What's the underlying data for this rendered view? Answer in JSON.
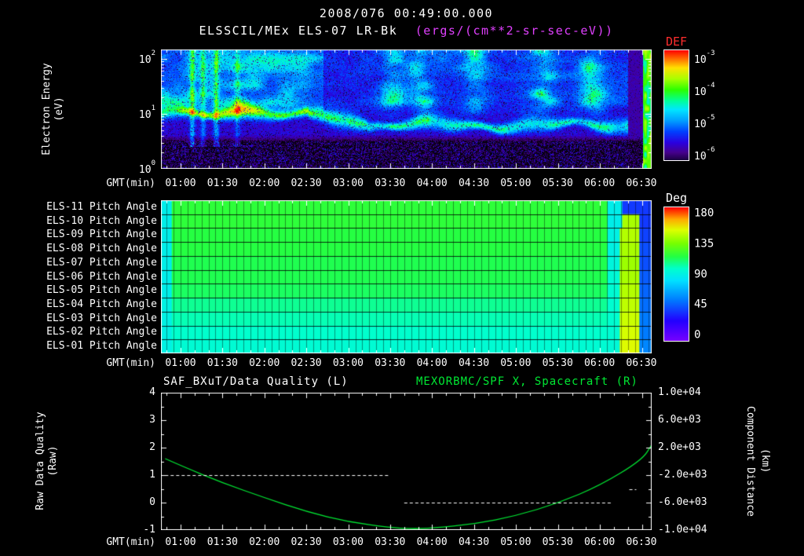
{
  "header": {
    "title": "2008/076 00:49:00.000"
  },
  "colors": {
    "background": "#000000",
    "foreground": "#ffffff",
    "panel1_units_magenta": "#e040ff",
    "def_label_red": "#ff2d2d",
    "right_title_green": "#00e833"
  },
  "time_axis": {
    "label": "GMT(min)",
    "ticks": [
      "01:00",
      "01:30",
      "02:00",
      "02:30",
      "03:00",
      "03:30",
      "04:00",
      "04:30",
      "05:00",
      "05:30",
      "06:00",
      "06:30"
    ],
    "start_min": 46,
    "end_min": 397
  },
  "panel1": {
    "title": "ELSSCIL/MEx ELS-07 LR-Bk",
    "units": "(ergs/(cm**2-sr-sec-eV))",
    "ylabel": "Electron Energy",
    "ylabel_units": "(eV)",
    "yticks": [
      {
        "base": "10",
        "exp": "2"
      },
      {
        "base": "10",
        "exp": "1"
      },
      {
        "base": "10",
        "exp": "0"
      }
    ],
    "colorbar": {
      "label": "DEF",
      "ticks": [
        {
          "base": "10",
          "exp": "-3"
        },
        {
          "base": "10",
          "exp": "-4"
        },
        {
          "base": "10",
          "exp": "-5"
        },
        {
          "base": "10",
          "exp": "-6"
        }
      ]
    }
  },
  "panel2": {
    "colorbar": {
      "label": "Deg",
      "ticks": [
        "180",
        "135",
        "90",
        "45",
        "0"
      ]
    }
  },
  "panel3": {
    "title_left": "SAF_BXuT/Data Quality (L)",
    "title_right": "MEXORBMC/SPF X, Spacecraft (R)",
    "ylabel_left": "Raw Data Quality",
    "ylabel_left_units": "(Raw)",
    "yticks_left": [
      "4",
      "3",
      "2",
      "1",
      "0",
      "-1"
    ],
    "ylabel_right": "Component Distance",
    "ylabel_right_units": "(km)",
    "yticks_right": [
      "1.0e+04",
      "6.0e+03",
      "2.0e+03",
      "-2.0e+03",
      "-6.0e+03",
      "-1.0e+04"
    ]
  },
  "chart_data": [
    {
      "type": "heatmap",
      "subtype": "energy-time-spectrogram",
      "title": "ELSSCIL/MEx ELS-07 LR-Bk",
      "zlabel": "DEF (ergs/(cm**2-sr-sec-eV))",
      "xlabel": "GMT(min)",
      "ylabel": "Electron Energy (eV)",
      "yscale": "log",
      "ylim_eV": [
        1,
        150
      ],
      "zlim": [
        1e-06,
        0.001
      ],
      "x_range": [
        "00:46",
        "06:37"
      ],
      "x_ticks": [
        "01:00",
        "01:30",
        "02:00",
        "02:30",
        "03:00",
        "03:30",
        "04:00",
        "04:30",
        "05:00",
        "05:30",
        "06:00",
        "06:30"
      ],
      "features": [
        "broad cyan-green electron flux 5-100 eV from 01:00 to 02:30",
        "narrow cyan band near 6-10 eV wavering across the full interval",
        "patchy cyan and green clouds 20-150 eV between 03:30 and 06:10",
        "dark speckled low-flux background below ~3 eV",
        "dark blue gap near 06:20 then bright green full-height column at ~06:33"
      ]
    },
    {
      "type": "heatmap",
      "subtype": "pitch-angle-rows",
      "zlabel": "Deg",
      "zlim": [
        0,
        180
      ],
      "rows": [
        {
          "label": "ELS-11 Pitch Angle",
          "segments": [
            [
              0,
              0.022,
              88
            ],
            [
              0.022,
              0.91,
              116
            ],
            [
              0.91,
              0.94,
              88
            ],
            [
              0.94,
              1,
              40
            ]
          ]
        },
        {
          "label": "ELS-10 Pitch Angle",
          "segments": [
            [
              0,
              0.022,
              88
            ],
            [
              0.022,
              0.91,
              116
            ],
            [
              0.91,
              0.94,
              88
            ],
            [
              0.94,
              0.975,
              140
            ],
            [
              0.975,
              1,
              40
            ]
          ]
        },
        {
          "label": "ELS-09 Pitch Angle",
          "segments": [
            [
              0,
              0.022,
              88
            ],
            [
              0.022,
              0.91,
              114
            ],
            [
              0.91,
              0.935,
              90
            ],
            [
              0.935,
              0.975,
              142
            ],
            [
              0.975,
              1,
              42
            ]
          ]
        },
        {
          "label": "ELS-08 Pitch Angle",
          "segments": [
            [
              0,
              0.022,
              88
            ],
            [
              0.022,
              0.91,
              114
            ],
            [
              0.91,
              0.935,
              90
            ],
            [
              0.935,
              0.975,
              140
            ],
            [
              0.975,
              1,
              45
            ]
          ]
        },
        {
          "label": "ELS-07 Pitch Angle",
          "segments": [
            [
              0,
              0.022,
              88
            ],
            [
              0.022,
              0.91,
              112
            ],
            [
              0.91,
              0.935,
              92
            ],
            [
              0.935,
              0.975,
              138
            ],
            [
              0.975,
              1,
              45
            ]
          ]
        },
        {
          "label": "ELS-06 Pitch Angle",
          "segments": [
            [
              0,
              0.022,
              88
            ],
            [
              0.022,
              0.91,
              112
            ],
            [
              0.91,
              0.935,
              94
            ],
            [
              0.935,
              0.975,
              140
            ],
            [
              0.975,
              1,
              48
            ]
          ]
        },
        {
          "label": "ELS-05 Pitch Angle",
          "segments": [
            [
              0,
              0.022,
              88
            ],
            [
              0.022,
              0.91,
              110
            ],
            [
              0.91,
              0.935,
              95
            ],
            [
              0.935,
              0.975,
              142
            ],
            [
              0.975,
              1,
              50
            ]
          ]
        },
        {
          "label": "ELS-04 Pitch Angle",
          "segments": [
            [
              0,
              0.022,
              90
            ],
            [
              0.022,
              0.91,
              104
            ],
            [
              0.91,
              0.935,
              96
            ],
            [
              0.935,
              0.975,
              144
            ],
            [
              0.975,
              1,
              52
            ]
          ]
        },
        {
          "label": "ELS-03 Pitch Angle",
          "segments": [
            [
              0,
              0.022,
              90
            ],
            [
              0.022,
              0.91,
              100
            ],
            [
              0.91,
              0.935,
              96
            ],
            [
              0.935,
              0.975,
              146
            ],
            [
              0.975,
              1,
              55
            ]
          ]
        },
        {
          "label": "ELS-02 Pitch Angle",
          "segments": [
            [
              0,
              0.022,
              90
            ],
            [
              0.022,
              0.91,
              97
            ],
            [
              0.91,
              0.935,
              95
            ],
            [
              0.935,
              0.975,
              148
            ],
            [
              0.975,
              1,
              55
            ]
          ]
        },
        {
          "label": "ELS-01 Pitch Angle",
          "segments": [
            [
              0,
              0.022,
              90
            ],
            [
              0.022,
              0.91,
              95
            ],
            [
              0.91,
              0.935,
              94
            ],
            [
              0.935,
              0.975,
              150
            ],
            [
              0.975,
              1,
              58
            ]
          ]
        }
      ]
    },
    {
      "type": "line",
      "xlabel": "GMT(min)",
      "left_axis": {
        "label": "Raw Data Quality (Raw)",
        "range": [
          -1,
          4
        ]
      },
      "right_axis": {
        "label": "Component Distance (km)",
        "range": [
          -10000,
          10000
        ]
      },
      "series": [
        {
          "name": "MEXORBMC/SPF X, Spacecraft (R)",
          "axis": "right",
          "color": "#00e833",
          "x_min": [
            49,
            60,
            90,
            120,
            150,
            180,
            210,
            225,
            240,
            270,
            300,
            330,
            360,
            390,
            397
          ],
          "y_km": [
            400,
            -600,
            -3120,
            -5280,
            -7320,
            -8800,
            -9640,
            -9800,
            -9720,
            -9120,
            -7920,
            -6080,
            -3520,
            200,
            2400
          ]
        },
        {
          "name": "SAF_BXuT/Data Quality (L)",
          "axis": "left",
          "color": "#ffffff",
          "style": "dashed",
          "segments": [
            {
              "x0_min": 49,
              "x1_min": 210,
              "y": 1
            },
            {
              "x0_min": 220,
              "x1_min": 368,
              "y": 0
            },
            {
              "x0_min": 381,
              "x1_min": 386,
              "y": 0.5
            }
          ]
        }
      ]
    }
  ]
}
